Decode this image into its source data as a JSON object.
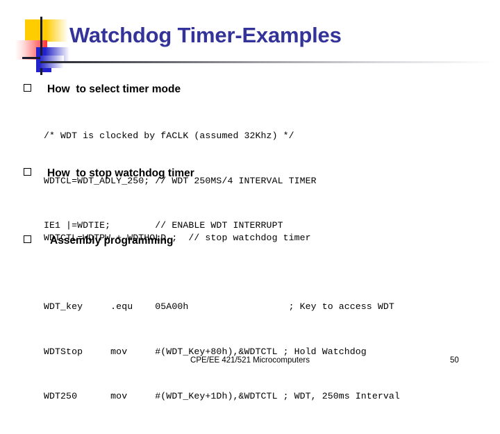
{
  "slide": {
    "title": "Watchdog Timer-Examples",
    "title_color": "#333399",
    "background_color": "#ffffff",
    "logo": {
      "yellow": "#ffcc00",
      "red": "#ff3333",
      "blue": "#2222cc",
      "line": "#1a1a2e"
    },
    "sections": [
      {
        "bullet": "□",
        "heading": "How  to select timer mode",
        "code": [
          "/* WDT is clocked by fACLK (assumed 32Khz) */",
          "WDTCL=WDT_ADLY_250; // WDT 250MS/4 INTERVAL TIMER",
          "IE1 |=WDTIE;        // ENABLE WDT INTERRUPT"
        ]
      },
      {
        "bullet": "□",
        "heading": "How  to stop watchdog timer",
        "code": [
          "WDTCTL=WDTPW + WDTHOLD ;  // stop watchdog timer"
        ]
      },
      {
        "bullet": "□",
        "heading": "Assembly programming",
        "code": [
          "WDT_key     .equ    05A00h                  ; Key to access WDT",
          "WDTStop     mov     #(WDT_Key+80h),&WDTCTL ; Hold Watchdog",
          "WDT250      mov     #(WDT_Key+1Dh),&WDTCTL ; WDT, 250ms Interval"
        ]
      }
    ],
    "footer": {
      "text": "CPE/EE 421/521 Microcomputers",
      "page_number": "50"
    }
  }
}
